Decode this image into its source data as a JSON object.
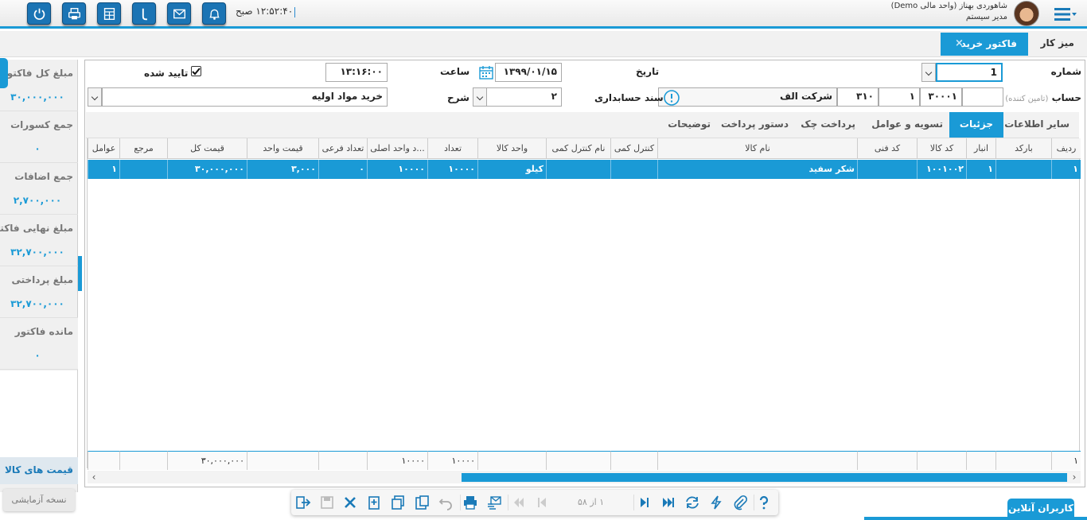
{
  "topbar": {
    "clock": "۱۲:۵۲:۴۰ صبح",
    "user_name": "شاهوردی بهناز (واحد مالی Demo)",
    "user_role": "مدیر سیستم",
    "icons": [
      "power-icon",
      "printer-icon",
      "calculator-icon",
      "phone-icon",
      "mail-icon",
      "bell-icon"
    ]
  },
  "tabs": {
    "desk": "میز کار",
    "active": "فاکتور خرید",
    "close": "×"
  },
  "summary": [
    {
      "title": "مبلغ کل فاکتور",
      "value": "۳۰,۰۰۰,۰۰۰"
    },
    {
      "title": "جمع کسورات",
      "value": "۰"
    },
    {
      "title": "جمع اضافات",
      "value": "۲,۷۰۰,۰۰۰"
    },
    {
      "title": "مبلغ نهایی فاکتور",
      "value": "۳۲,۷۰۰,۰۰۰"
    },
    {
      "title": "مبلغ پرداختی",
      "value": "۳۲,۷۰۰,۰۰۰"
    },
    {
      "title": "مانده فاکتور",
      "value": "۰"
    }
  ],
  "left_bottom": {
    "prices": "قیمت های کالا",
    "demo": "نسخه آزمایشی"
  },
  "form": {
    "number_label": "شماره",
    "number_value": "1",
    "date_label": "تاریخ",
    "date_value": "۱۳۹۹/۰۱/۱۵",
    "time_label": "ساعت",
    "time_value": "۱۳:۱۶:۰۰",
    "approved_label": "تایید شده",
    "account_label": "حساب",
    "account_hint": "(تامین کننده)",
    "account_codes": [
      "۳۰۰۰۱",
      "۱",
      "۳۱۰"
    ],
    "account_name": "شرکت الف",
    "voucher_label": "سند حسابداری",
    "desc_label": "شرح",
    "desc_code": "۲",
    "desc_value": "خرید مواد اولیه"
  },
  "inner_tabs": [
    "سایر اطلاعات",
    "جزئیات",
    "تسویه و عوامل",
    "پرداخت چک",
    "دستور پرداخت",
    "توضیحات"
  ],
  "grid": {
    "headers": [
      "ردیف",
      "بارکد",
      "انبار",
      "کد کالا",
      "کد فنی",
      "نام کالا",
      "کنترل کمی",
      "نام کنترل کمی",
      "واحد کالا",
      "تعداد",
      "...د واحد اصلی",
      "تعداد فرعی",
      "قیمت واحد",
      "قیمت کل",
      "مرجع",
      "عوامل"
    ],
    "row": [
      "۱",
      "",
      "۱",
      "۱۰۰۱۰۰۲",
      "",
      "شکر سفید",
      "",
      "",
      "کیلو",
      "۱۰۰۰۰",
      "۱۰۰۰۰",
      "۰",
      "۳,۰۰۰",
      "۳۰,۰۰۰,۰۰۰",
      "",
      "۱"
    ],
    "footer": [
      "۱",
      "",
      "",
      "",
      "",
      "",
      "",
      "",
      "",
      "۱۰۰۰۰",
      "۱۰۰۰۰",
      "",
      "",
      "۳۰,۰۰۰,۰۰۰",
      "",
      ""
    ]
  },
  "toolbar": {
    "pager": "۱ از ۵۸"
  },
  "online_users": "کاربران آنلاین"
}
